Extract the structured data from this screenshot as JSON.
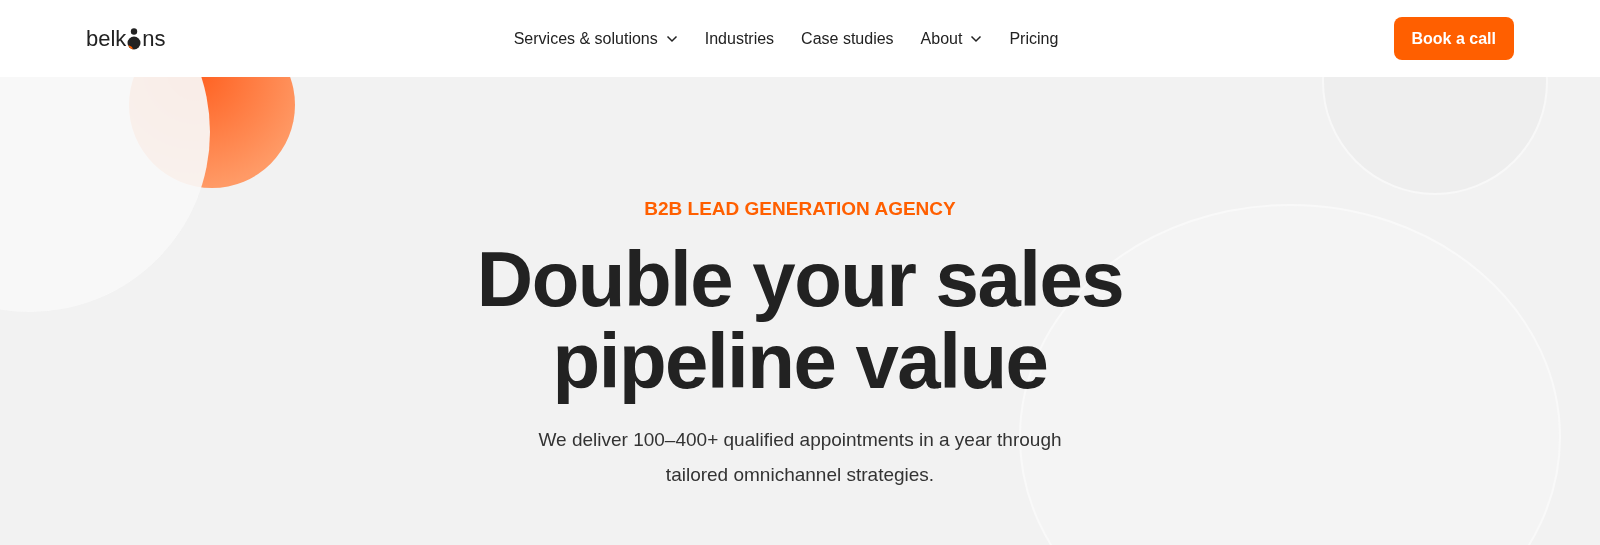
{
  "header": {
    "logo": {
      "before": "belk",
      "after": "ns"
    },
    "nav": [
      {
        "label": "Services & solutions",
        "has_menu": true
      },
      {
        "label": "Industries",
        "has_menu": false
      },
      {
        "label": "Case studies",
        "has_menu": false
      },
      {
        "label": "About",
        "has_menu": true
      },
      {
        "label": "Pricing",
        "has_menu": false
      }
    ],
    "cta": "Book a call"
  },
  "hero": {
    "eyebrow": "B2B LEAD GENERATION AGENCY",
    "title_lines": [
      "Double your sales",
      "pipeline value"
    ],
    "subtitle_lines": [
      "We deliver 100–400+ qualified appointments in a year through",
      "tailored omnichannel strategies."
    ]
  }
}
